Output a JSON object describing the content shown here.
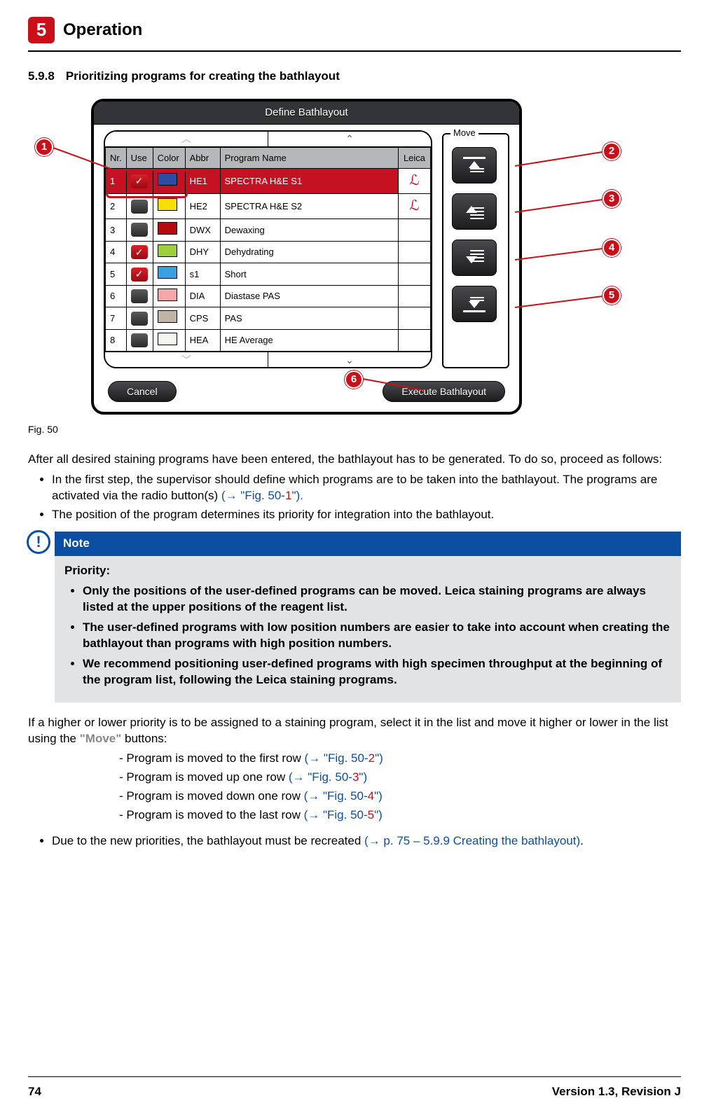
{
  "chapter": {
    "number": "5",
    "title": "Operation"
  },
  "section": {
    "number": "5.9.8",
    "title": "Prioritizing programs for creating the bathlayout"
  },
  "figure": {
    "title": "Define Bathlayout",
    "move_label": "Move",
    "cancel": "Cancel",
    "execute": "Execute Bathlayout",
    "caption": "Fig. 50",
    "columns": {
      "nr": "Nr.",
      "use": "Use",
      "color": "Color",
      "abbr": "Abbr",
      "name": "Program Name",
      "leica": "Leica"
    },
    "rows": [
      {
        "nr": "1",
        "use": true,
        "color": "#2d4da3",
        "abbr": "HE1",
        "name": "SPECTRA H&E S1",
        "leica": true,
        "selected": true
      },
      {
        "nr": "2",
        "use": false,
        "color": "#f7e000",
        "abbr": "HE2",
        "name": "SPECTRA H&E S2",
        "leica": true,
        "selected": false
      },
      {
        "nr": "3",
        "use": false,
        "color": "#b40b12",
        "abbr": "DWX",
        "name": "Dewaxing",
        "leica": false,
        "selected": false
      },
      {
        "nr": "4",
        "use": true,
        "color": "#9dd03a",
        "abbr": "DHY",
        "name": "Dehydrating",
        "leica": false,
        "selected": false
      },
      {
        "nr": "5",
        "use": true,
        "color": "#3aa0e0",
        "abbr": "s1",
        "name": "Short",
        "leica": false,
        "selected": false
      },
      {
        "nr": "6",
        "use": false,
        "color": "#f3a7a9",
        "abbr": "DIA",
        "name": "Diastase PAS",
        "leica": false,
        "selected": false
      },
      {
        "nr": "7",
        "use": false,
        "color": "#bfb4a5",
        "abbr": "CPS",
        "name": "PAS",
        "leica": false,
        "selected": false
      },
      {
        "nr": "8",
        "use": false,
        "color": "#f6f6f0",
        "abbr": "HEA",
        "name": "HE Average",
        "leica": false,
        "selected": false
      }
    ]
  },
  "callouts": [
    "1",
    "2",
    "3",
    "4",
    "5",
    "6"
  ],
  "para1": "After all desired staining programs have been entered, the bathlayout has to be generated. To do so, proceed as follows:",
  "bullets1": [
    {
      "text": "In the first step, the supervisor should define which programs are to be taken into the bathlayout. The programs are activated via the radio button(s) ",
      "ref_pre": "(→ \"Fig. 50-",
      "ref_num": "1",
      "ref_post": "\")."
    },
    {
      "text": "The position of the program determines its priority for integration into the bathlayout."
    }
  ],
  "note": {
    "title": "Note",
    "lead": "Priority:",
    "items": [
      "Only the positions of the user-defined programs can be moved. Leica staining programs are always listed at the upper positions of the reagent list.",
      "The user-defined programs with low position numbers are easier to take into account when creating the bathlayout than programs with high position numbers.",
      "We recommend positioning user-defined programs with high specimen throughput at the beginning of the program list, following the Leica staining programs."
    ]
  },
  "para2_a": "If a higher or lower priority is to be assigned to a staining program, select it in the list and move it higher or lower in the list using the ",
  "para2_move": "\"Move\"",
  "para2_b": " buttons:",
  "moveList": [
    {
      "text": "Program is moved to the first row ",
      "num": "2"
    },
    {
      "text": "Program is moved up one row ",
      "num": "3"
    },
    {
      "text": "Program is moved down one row ",
      "num": "4"
    },
    {
      "text": "Program is moved to the last row ",
      "num": "5"
    }
  ],
  "ref_fig_prefix": "(→ \"Fig. 50-",
  "ref_fig_suffix": "\")",
  "bullet_last": {
    "text": "Due to the new priorities, the bathlayout must be recreated ",
    "ref": "(→ p. 75 – 5.9.9 Creating the bathlayout)"
  },
  "footer": {
    "page": "74",
    "version": "Version 1.3, Revision J"
  }
}
